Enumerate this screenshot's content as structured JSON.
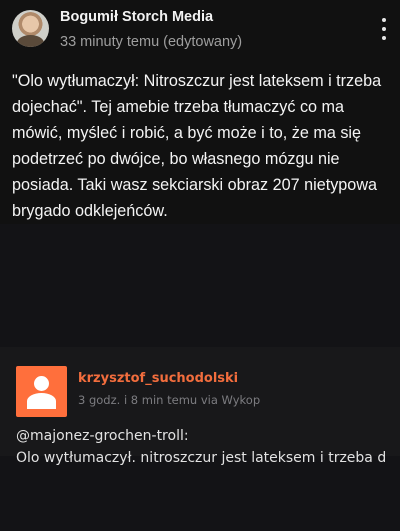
{
  "post": {
    "author": "Bogumił Storch Media",
    "time": "33 minuty temu (edytowany)",
    "text": "\"Olo wytłumaczył: Nitroszczur jest lateksem i trzeba dojechać\". Tej amebie trzeba tłumaczyć co ma mówić, myśleć i robić, a być może i  to, że ma się podetrzeć po dwójce, bo własnego mózgu nie posiada. Taki wasz sekciarski obraz 207 nietypowa brygado odklejeńców.",
    "menu_icon": "kebab-menu-icon",
    "avatar_icon": "profile-photo"
  },
  "embedded_screenshot": {
    "username": "krzysztof_suchodolski",
    "meta": "3 godz. i 8 min temu  via Wykop",
    "reply_to": "@majonez-grochen-troll:",
    "text": "Olo wytłumaczył. nitroszczur jest lateksem i trzeba d",
    "avatar_icon": "default-user-icon",
    "username_color": "#f26d3d",
    "avatar_color": "#ff6f3c"
  }
}
